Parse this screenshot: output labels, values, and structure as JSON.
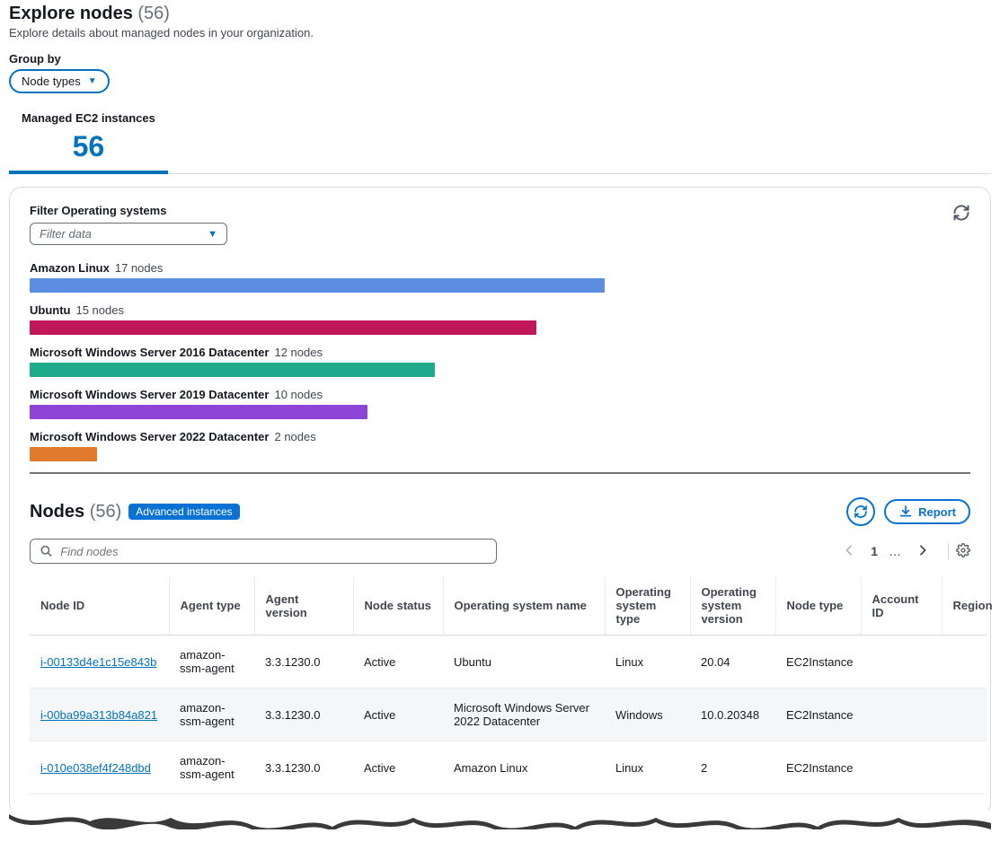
{
  "header": {
    "title": "Explore nodes",
    "count": "(56)",
    "subtitle": "Explore details about managed nodes in your organization."
  },
  "groupby": {
    "label": "Group by",
    "selected": "Node types"
  },
  "tab": {
    "label": "Managed EC2 instances",
    "value": "56"
  },
  "filter": {
    "title": "Filter Operating systems",
    "placeholder": "Filter data"
  },
  "chart_data": {
    "type": "bar",
    "orientation": "horizontal",
    "xlabel": "",
    "ylabel": "",
    "max": 17,
    "series": [
      {
        "name": "Amazon Linux",
        "value": 17,
        "suffix": "17 nodes",
        "color": "#5b8ee0"
      },
      {
        "name": "Ubuntu",
        "value": 15,
        "suffix": "15 nodes",
        "color": "#c2185b"
      },
      {
        "name": "Microsoft Windows Server 2016 Datacenter",
        "value": 12,
        "suffix": "12 nodes",
        "color": "#1fab89"
      },
      {
        "name": "Microsoft Windows Server 2019 Datacenter",
        "value": 10,
        "suffix": "10 nodes",
        "color": "#8e44d6"
      },
      {
        "name": "Microsoft Windows Server 2022 Datacenter",
        "value": 2,
        "suffix": "2 nodes",
        "color": "#e07b2e"
      }
    ]
  },
  "nodes": {
    "title": "Nodes",
    "count": "(56)",
    "badge": "Advanced instances",
    "report": "Report",
    "search_placeholder": "Find nodes",
    "page": "1",
    "columns": [
      "Node ID",
      "Agent type",
      "Agent version",
      "Node status",
      "Operating system name",
      "Operating system type",
      "Operating system version",
      "Node type",
      "Account ID",
      "Region"
    ],
    "rows": [
      {
        "id": "i-00133d4e1c15e843b",
        "agent": "amazon-ssm-agent",
        "ver": "3.3.1230.0",
        "status": "Active",
        "osname": "Ubuntu",
        "ostype": "Linux",
        "osver": "20.04",
        "ntype": "EC2Instance",
        "acct": "",
        "region": ""
      },
      {
        "id": "i-00ba99a313b84a821",
        "agent": "amazon-ssm-agent",
        "ver": "3.3.1230.0",
        "status": "Active",
        "osname": "Microsoft Windows Server 2022 Datacenter",
        "ostype": "Windows",
        "osver": "10.0.20348",
        "ntype": "EC2Instance",
        "acct": "",
        "region": ""
      },
      {
        "id": "i-010e038ef4f248dbd",
        "agent": "amazon-ssm-agent",
        "ver": "3.3.1230.0",
        "status": "Active",
        "osname": "Amazon Linux",
        "ostype": "Linux",
        "osver": "2",
        "ntype": "EC2Instance",
        "acct": "",
        "region": ""
      }
    ]
  }
}
